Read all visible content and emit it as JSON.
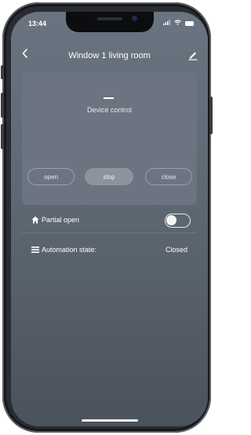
{
  "status_bar": {
    "time": "13:44"
  },
  "header": {
    "title": "Window 1 living room"
  },
  "device_card": {
    "state_symbol": "–",
    "label": "Device control",
    "buttons": {
      "open": "open",
      "stop": "stop",
      "close": "close"
    }
  },
  "partial_open": {
    "label": "Partial open",
    "enabled": false
  },
  "automation": {
    "label": "Automation state:",
    "value": "Closed"
  }
}
